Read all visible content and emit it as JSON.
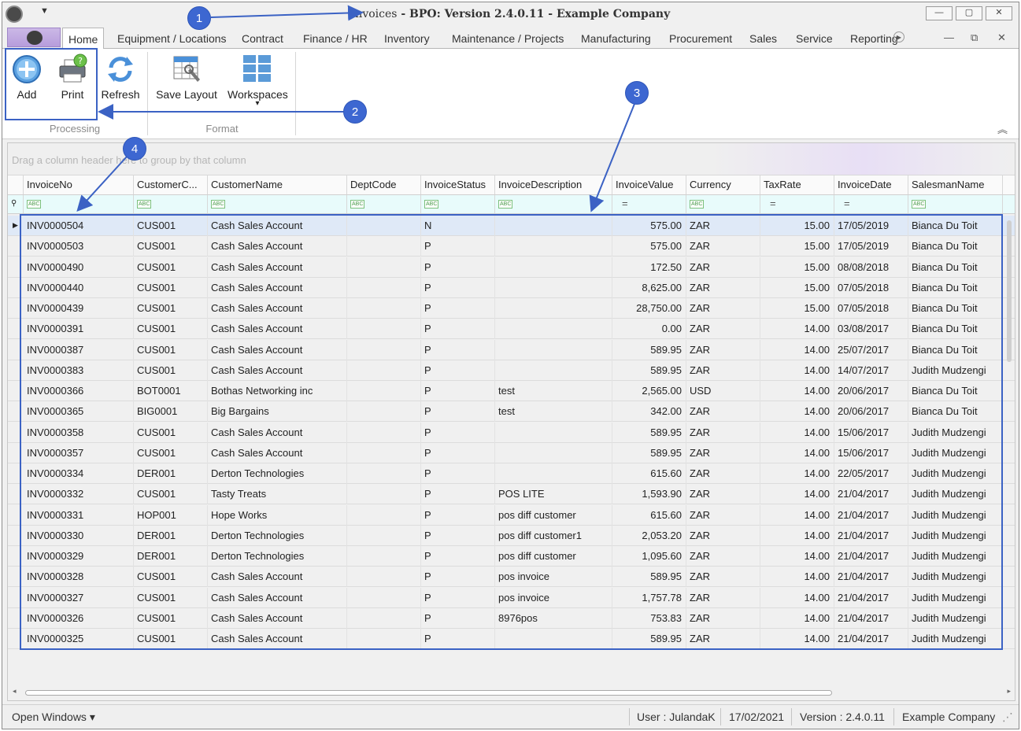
{
  "window": {
    "title_prefix": "Invoices",
    "title_rest": " - BPO: Version 2.4.0.11 - Example Company",
    "qat_glyph": "▼",
    "controls": {
      "minimize": "—",
      "restore": "▢",
      "close": "✕"
    }
  },
  "tabs": [
    {
      "label": "Home",
      "active": true
    },
    {
      "label": "Equipment / Locations"
    },
    {
      "label": "Contract"
    },
    {
      "label": "Finance / HR"
    },
    {
      "label": "Inventory"
    },
    {
      "label": "Maintenance / Projects"
    },
    {
      "label": "Manufacturing"
    },
    {
      "label": "Procurement"
    },
    {
      "label": "Sales"
    },
    {
      "label": "Service"
    },
    {
      "label": "Reporting"
    }
  ],
  "tab_controls": {
    "more": "▸",
    "min": "—",
    "restore": "⧉",
    "close": "✕"
  },
  "ribbon": {
    "groups": [
      {
        "label": "Processing",
        "buttons": [
          {
            "label": "Add",
            "icon": "add-icon"
          },
          {
            "label": "Print",
            "icon": "printer-icon"
          },
          {
            "label": "Refresh",
            "icon": "refresh-icon"
          }
        ]
      },
      {
        "label": "Format",
        "buttons": [
          {
            "label": "Save Layout",
            "icon": "save-layout-icon"
          },
          {
            "label": "Workspaces",
            "icon": "workspaces-icon",
            "dropdown": "▾"
          }
        ]
      }
    ],
    "collapse_glyph": "︽"
  },
  "grid": {
    "group_panel_text": "Drag a column header here to group by that column",
    "columns": [
      "InvoiceNo",
      "CustomerC...",
      "CustomerName",
      "DeptCode",
      "InvoiceStatus",
      "InvoiceDescription",
      "InvoiceValue",
      "Currency",
      "TaxRate",
      "InvoiceDate",
      "SalesmanName"
    ],
    "filter_types": [
      "abc",
      "abc",
      "abc",
      "abc",
      "abc",
      "abc",
      "eq",
      "abc",
      "eq",
      "eq",
      "abc"
    ],
    "filter_eq_glyph": "=",
    "filter_abc_glyph": "ABC",
    "filter_pin_glyph": "⚲",
    "selected_marker": "▶",
    "rows": [
      [
        "INV0000504",
        "CUS001",
        "Cash Sales Account",
        "",
        "N",
        "",
        "575.00",
        "ZAR",
        "15.00",
        "17/05/2019",
        "Bianca Du Toit"
      ],
      [
        "INV0000503",
        "CUS001",
        "Cash Sales Account",
        "",
        "P",
        "",
        "575.00",
        "ZAR",
        "15.00",
        "17/05/2019",
        "Bianca Du Toit"
      ],
      [
        "INV0000490",
        "CUS001",
        "Cash Sales Account",
        "",
        "P",
        "",
        "172.50",
        "ZAR",
        "15.00",
        "08/08/2018",
        "Bianca Du Toit"
      ],
      [
        "INV0000440",
        "CUS001",
        "Cash Sales Account",
        "",
        "P",
        "",
        "8,625.00",
        "ZAR",
        "15.00",
        "07/05/2018",
        "Bianca Du Toit"
      ],
      [
        "INV0000439",
        "CUS001",
        "Cash Sales Account",
        "",
        "P",
        "",
        "28,750.00",
        "ZAR",
        "15.00",
        "07/05/2018",
        "Bianca Du Toit"
      ],
      [
        "INV0000391",
        "CUS001",
        "Cash Sales Account",
        "",
        "P",
        "",
        "0.00",
        "ZAR",
        "14.00",
        "03/08/2017",
        "Bianca Du Toit"
      ],
      [
        "INV0000387",
        "CUS001",
        "Cash Sales Account",
        "",
        "P",
        "",
        "589.95",
        "ZAR",
        "14.00",
        "25/07/2017",
        "Bianca Du Toit"
      ],
      [
        "INV0000383",
        "CUS001",
        "Cash Sales Account",
        "",
        "P",
        "",
        "589.95",
        "ZAR",
        "14.00",
        "14/07/2017",
        "Judith Mudzengi"
      ],
      [
        "INV0000366",
        "BOT0001",
        "Bothas Networking inc",
        "",
        "P",
        "test",
        "2,565.00",
        "USD",
        "14.00",
        "20/06/2017",
        "Bianca Du Toit"
      ],
      [
        "INV0000365",
        "BIG0001",
        "Big Bargains",
        "",
        "P",
        "test",
        "342.00",
        "ZAR",
        "14.00",
        "20/06/2017",
        "Bianca Du Toit"
      ],
      [
        "INV0000358",
        "CUS001",
        "Cash Sales Account",
        "",
        "P",
        "",
        "589.95",
        "ZAR",
        "14.00",
        "15/06/2017",
        "Judith Mudzengi"
      ],
      [
        "INV0000357",
        "CUS001",
        "Cash Sales Account",
        "",
        "P",
        "",
        "589.95",
        "ZAR",
        "14.00",
        "15/06/2017",
        "Judith Mudzengi"
      ],
      [
        "INV0000334",
        "DER001",
        "Derton Technologies",
        "",
        "P",
        "",
        "615.60",
        "ZAR",
        "14.00",
        "22/05/2017",
        "Judith Mudzengi"
      ],
      [
        "INV0000332",
        "CUS001",
        "Tasty Treats",
        "",
        "P",
        "POS LITE",
        "1,593.90",
        "ZAR",
        "14.00",
        "21/04/2017",
        "Judith Mudzengi"
      ],
      [
        "INV0000331",
        "HOP001",
        "Hope Works",
        "",
        "P",
        "pos diff customer",
        "615.60",
        "ZAR",
        "14.00",
        "21/04/2017",
        "Judith Mudzengi"
      ],
      [
        "INV0000330",
        "DER001",
        "Derton Technologies",
        "",
        "P",
        "pos diff customer1",
        "2,053.20",
        "ZAR",
        "14.00",
        "21/04/2017",
        "Judith Mudzengi"
      ],
      [
        "INV0000329",
        "DER001",
        "Derton Technologies",
        "",
        "P",
        "pos diff customer",
        "1,095.60",
        "ZAR",
        "14.00",
        "21/04/2017",
        "Judith Mudzengi"
      ],
      [
        "INV0000328",
        "CUS001",
        "Cash Sales Account",
        "",
        "P",
        "pos invoice",
        "589.95",
        "ZAR",
        "14.00",
        "21/04/2017",
        "Judith Mudzengi"
      ],
      [
        "INV0000327",
        "CUS001",
        "Cash Sales Account",
        "",
        "P",
        "pos invoice",
        "1,757.78",
        "ZAR",
        "14.00",
        "21/04/2017",
        "Judith Mudzengi"
      ],
      [
        "INV0000326",
        "CUS001",
        "Cash Sales Account",
        "",
        "P",
        "8976pos",
        "753.83",
        "ZAR",
        "14.00",
        "21/04/2017",
        "Judith Mudzengi"
      ],
      [
        "INV0000325",
        "CUS001",
        "Cash Sales Account",
        "",
        "P",
        "",
        "589.95",
        "ZAR",
        "14.00",
        "21/04/2017",
        "Judith Mudzengi"
      ]
    ],
    "selected_row": 0
  },
  "statusbar": {
    "open_windows": "Open Windows ▾",
    "user": "User : JulandaK",
    "date": "17/02/2021",
    "version": "Version : 2.4.0.11",
    "company": "Example Company",
    "grip": "⋰"
  },
  "annotations": [
    "1",
    "2",
    "3",
    "4"
  ],
  "colors": {
    "annotation": "#3d67d1",
    "selected_row": "#dfe9f7",
    "filter_row": "#e8fbfb"
  }
}
